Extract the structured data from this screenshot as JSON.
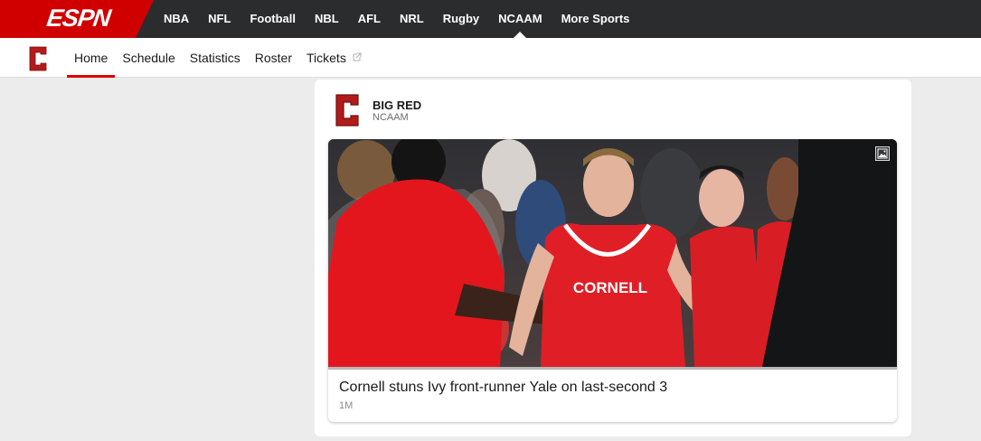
{
  "brand": {
    "logo_text": "ESPN",
    "accent": "#d00000",
    "nav_bg": "#2b2c2d"
  },
  "top_nav": {
    "items": [
      {
        "label": "NBA"
      },
      {
        "label": "NFL"
      },
      {
        "label": "Football"
      },
      {
        "label": "NBL"
      },
      {
        "label": "AFL"
      },
      {
        "label": "NRL"
      },
      {
        "label": "Rugby"
      },
      {
        "label": "NCAAM",
        "active": true
      },
      {
        "label": "More Sports"
      }
    ]
  },
  "team_nav": {
    "logo_icon": "cornell-c-logo",
    "items": [
      {
        "label": "Home",
        "active": true
      },
      {
        "label": "Schedule"
      },
      {
        "label": "Statistics"
      },
      {
        "label": "Roster"
      },
      {
        "label": "Tickets",
        "icon": "external-link-icon"
      }
    ]
  },
  "card": {
    "team_name": "BIG RED",
    "league": "NCAAM",
    "team_color": "#b31b1b",
    "story": {
      "image_icon": "image-icon",
      "jersey_text": "CORNELL",
      "headline": "Cornell stuns Ivy front-runner Yale on last-second 3",
      "timestamp": "1M"
    }
  }
}
